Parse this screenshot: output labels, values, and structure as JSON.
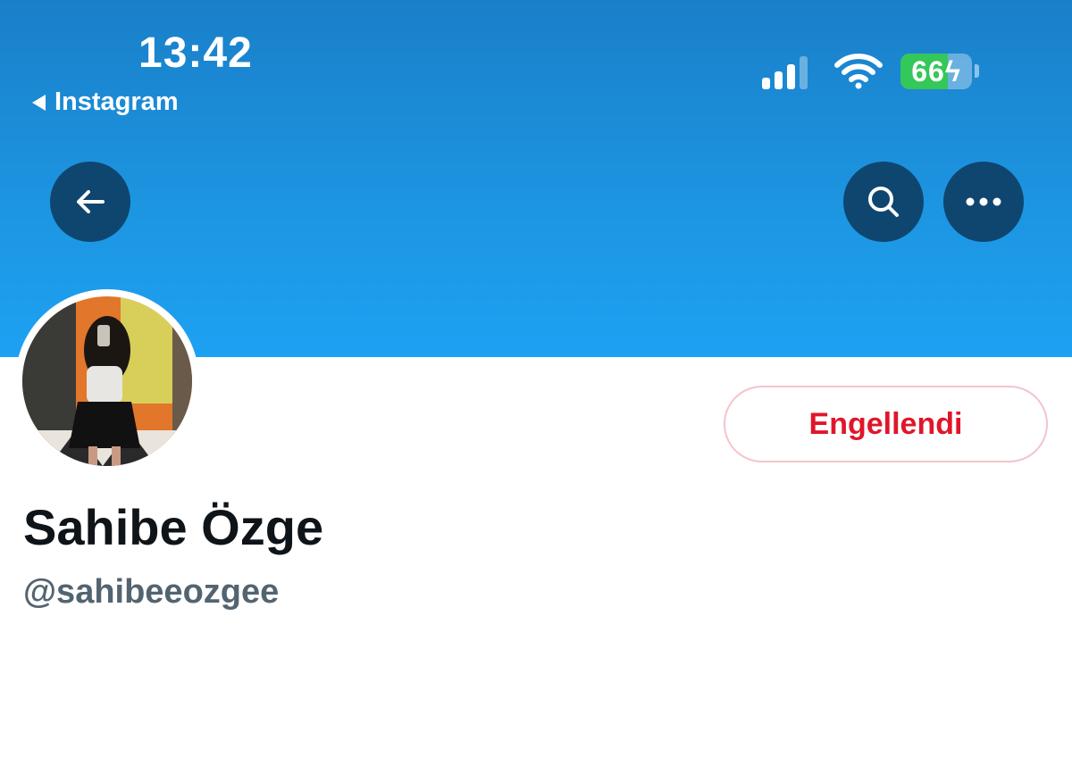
{
  "status_bar": {
    "time": "13:42",
    "back_app": "Instagram",
    "battery_level": "66",
    "battery_fraction": 0.66,
    "battery_charging": true,
    "signal_bars": 3,
    "signal_max": 4
  },
  "header": {
    "back_icon": "arrow-left-icon",
    "search_icon": "search-icon",
    "more_icon": "more-horizontal-icon"
  },
  "profile": {
    "display_name": "Sahibe Özge",
    "handle": "@sahibeeozgee",
    "blocked_label": "Engellendi"
  },
  "colors": {
    "banner": "#1da1f2",
    "blocked_red": "#e0162b",
    "handle_gray": "#536471",
    "battery_green": "#34c759"
  }
}
